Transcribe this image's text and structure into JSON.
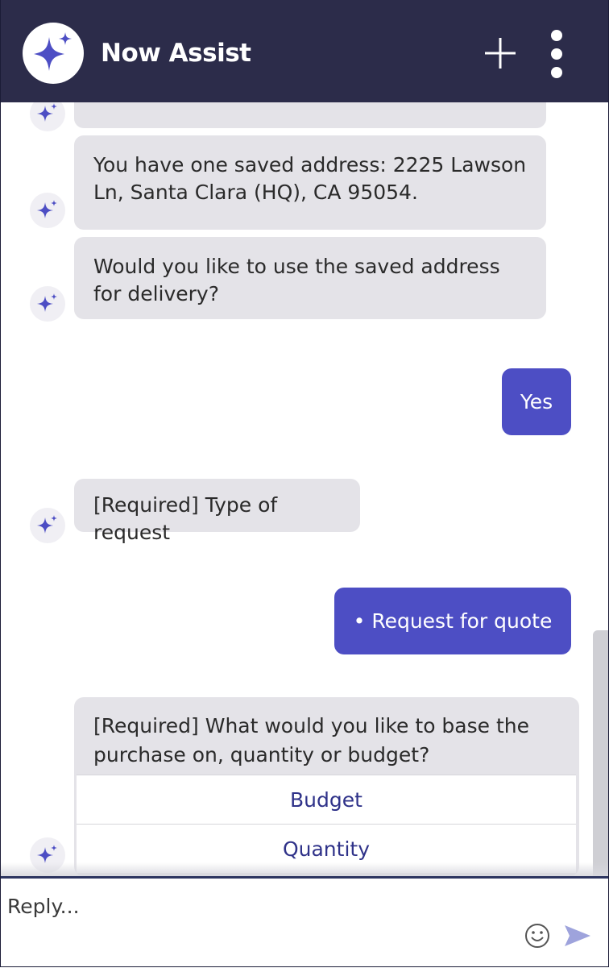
{
  "header": {
    "title": "Now Assist",
    "bg_color": "#2c2c4a",
    "icons": {
      "logo": "sparkle-icon",
      "new_chat": "plus-icon",
      "menu": "kebab-menu-icon"
    }
  },
  "messages": [
    {
      "from": "assistant",
      "text": "You have one saved address: 2225 Lawson Ln, Santa Clara (HQ), CA 95054."
    },
    {
      "from": "assistant",
      "text": "Would you like to use the saved address for delivery?"
    },
    {
      "from": "user",
      "text": "Yes"
    },
    {
      "from": "assistant",
      "text": "[Required] Type of request"
    },
    {
      "from": "user",
      "text": "• Request for quote"
    },
    {
      "from": "assistant",
      "text": "[Required] What would you like to base the purchase on, quantity or budget?",
      "options": [
        "Budget",
        "Quantity"
      ]
    }
  ],
  "composer": {
    "placeholder": "Reply...",
    "icons": [
      "smiley-icon",
      "send-icon"
    ]
  },
  "colors": {
    "accent": "#4d4ec4",
    "bubble_bg": "#e4e3e8",
    "option_text": "#2f3289"
  }
}
